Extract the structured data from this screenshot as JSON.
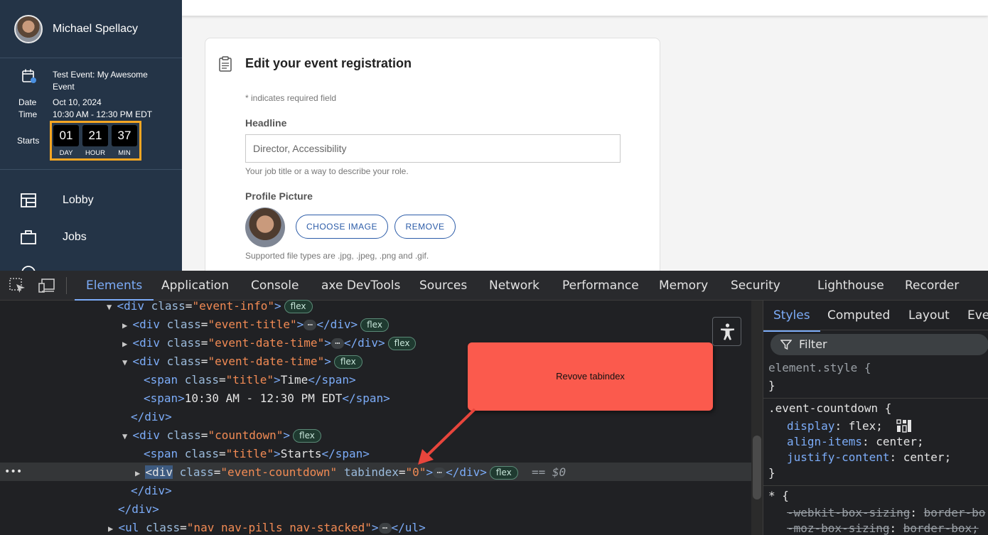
{
  "page": {
    "profile_name": "Michael Spellacy",
    "event": {
      "title": "Test Event: My Awesome Event",
      "date_label": "Date",
      "date_value": "Oct 10, 2024",
      "time_label": "Time",
      "time_value": "10:30 AM - 12:30 PM EDT",
      "starts_label": "Starts",
      "countdown": [
        {
          "num": "01",
          "unit": "DAY"
        },
        {
          "num": "21",
          "unit": "HOUR"
        },
        {
          "num": "37",
          "unit": "MIN"
        }
      ]
    },
    "nav": [
      "Lobby",
      "Jobs"
    ],
    "card": {
      "title": "Edit your event registration",
      "required_note": "* indicates required field",
      "headline_label": "Headline",
      "headline_value": "Director, Accessibility",
      "headline_help": "Your job title or a way to describe your role.",
      "picture_label": "Profile Picture",
      "choose_btn": "CHOOSE IMAGE",
      "remove_btn": "REMOVE",
      "file_help": "Supported file types are .jpg, .jpeg, .png and .gif."
    }
  },
  "devtools": {
    "tabs": [
      "Elements",
      "Application",
      "Console",
      "axe DevTools",
      "Sources",
      "Network",
      "Performance",
      "Memory",
      "Security",
      "Lighthouse",
      "Recorder"
    ],
    "active_tab": "Elements",
    "dom_lines": [
      {
        "tri": "▼",
        "parts": [
          [
            "tag",
            "<div "
          ],
          [
            "attr",
            "class"
          ],
          [
            "txt",
            "="
          ],
          [
            "aval",
            "\"event-info\""
          ],
          [
            "tag",
            ">"
          ]
        ],
        "badge": "flex"
      },
      {
        "tri": "▶",
        "parts": [
          [
            "tag",
            "<div "
          ],
          [
            "attr",
            "class"
          ],
          [
            "txt",
            "="
          ],
          [
            "aval",
            "\"event-title\""
          ],
          [
            "tag",
            ">"
          ],
          [
            "ell",
            "…"
          ],
          [
            "tag",
            "</div>"
          ]
        ],
        "badge": "flex"
      },
      {
        "tri": "▶",
        "parts": [
          [
            "tag",
            "<div "
          ],
          [
            "attr",
            "class"
          ],
          [
            "txt",
            "="
          ],
          [
            "aval",
            "\"event-date-time\""
          ],
          [
            "tag",
            ">"
          ],
          [
            "ell",
            "…"
          ],
          [
            "tag",
            "</div>"
          ]
        ],
        "badge": "flex"
      },
      {
        "tri": "▼",
        "parts": [
          [
            "tag",
            "<div "
          ],
          [
            "attr",
            "class"
          ],
          [
            "txt",
            "="
          ],
          [
            "aval",
            "\"event-date-time\""
          ],
          [
            "tag",
            ">"
          ]
        ],
        "badge": "flex"
      },
      {
        "tri": "",
        "parts": [
          [
            "tag",
            "<span "
          ],
          [
            "attr",
            "class"
          ],
          [
            "txt",
            "="
          ],
          [
            "aval",
            "\"title\""
          ],
          [
            "tag",
            ">"
          ],
          [
            "txt",
            "Time"
          ],
          [
            "tag",
            "</span>"
          ]
        ],
        "badge": ""
      },
      {
        "tri": "",
        "parts": [
          [
            "tag",
            "<span>"
          ],
          [
            "txt",
            "10:30 AM - 12:30 PM EDT"
          ],
          [
            "tag",
            "</span>"
          ]
        ],
        "badge": ""
      },
      {
        "tri": "",
        "parts": [
          [
            "tag",
            "</div>"
          ]
        ],
        "badge": ""
      },
      {
        "tri": "▼",
        "parts": [
          [
            "tag",
            "<div "
          ],
          [
            "attr",
            "class"
          ],
          [
            "txt",
            "="
          ],
          [
            "aval",
            "\"countdown\""
          ],
          [
            "tag",
            ">"
          ]
        ],
        "badge": "flex"
      },
      {
        "tri": "",
        "parts": [
          [
            "tag",
            "<span "
          ],
          [
            "attr",
            "class"
          ],
          [
            "txt",
            "="
          ],
          [
            "aval",
            "\"title\""
          ],
          [
            "tag",
            ">"
          ],
          [
            "txt",
            "Starts"
          ],
          [
            "tag",
            "</span>"
          ]
        ],
        "badge": ""
      },
      {
        "tri": "▶",
        "parts": [
          [
            "hl",
            "<div"
          ],
          [
            "attr",
            " class"
          ],
          [
            "txt",
            "="
          ],
          [
            "aval",
            "\"event-countdown\""
          ],
          [
            "attr",
            " tabindex"
          ],
          [
            "txt",
            "="
          ],
          [
            "aval",
            "\"0\""
          ],
          [
            "tag",
            ">"
          ],
          [
            "ell",
            "…"
          ],
          [
            "tag",
            "</div>"
          ]
        ],
        "badge": "flex",
        "suffix": "== $0"
      },
      {
        "tri": "",
        "parts": [
          [
            "tag",
            "</div>"
          ]
        ],
        "badge": ""
      },
      {
        "tri": "",
        "parts": [
          [
            "tag",
            "</div>"
          ]
        ],
        "badge": ""
      },
      {
        "tri": "▶",
        "parts": [
          [
            "tag",
            "<ul "
          ],
          [
            "attr",
            "class"
          ],
          [
            "txt",
            "="
          ],
          [
            "aval",
            "\"nav nav-pills nav-stacked\""
          ],
          [
            "tag",
            ">"
          ],
          [
            "ell",
            "…"
          ],
          [
            "tag",
            "</ul>"
          ]
        ],
        "badge": ""
      }
    ],
    "callout_text": "Revove tabindex",
    "styles_tabs": [
      "Styles",
      "Computed",
      "Layout",
      "Eve"
    ],
    "filter_placeholder": "Filter",
    "css": {
      "element_style": "element.style {",
      "close": "}",
      "rule_selector": ".event-countdown {",
      "decls": [
        {
          "prop": "display",
          "value": "flex;"
        },
        {
          "prop": "align-items",
          "value": "center;"
        },
        {
          "prop": "justify-content",
          "value": "center;"
        }
      ],
      "universal": "* {",
      "webkit": "-webkit-box-sizing",
      "webkit_val": "border-bo",
      "moz": "-moz-box-sizing",
      "moz_val": "border-box;"
    }
  }
}
